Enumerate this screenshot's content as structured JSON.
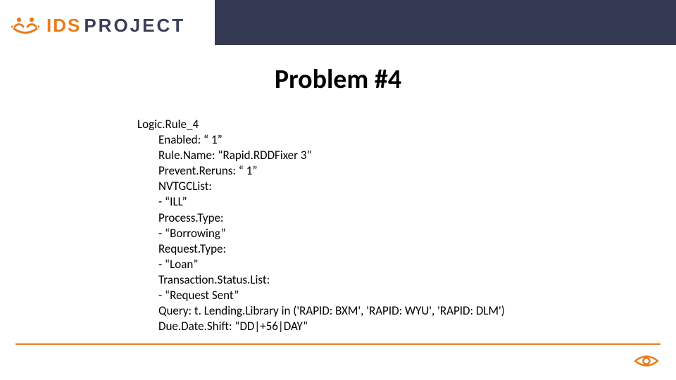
{
  "logo": {
    "ids": "IDS",
    "project": "PROJECT"
  },
  "title": "Problem #4",
  "body": {
    "root": "Logic.Rule_4",
    "lines": [
      "Enabled: “ 1”",
      "Rule.Name: “Rapid.RDDFixer 3”",
      "Prevent.Reruns: “ 1”",
      "NVTGCList:",
      "- “ILL”",
      "Process.Type:",
      "- “Borrowing”",
      "Request.Type:",
      "- “Loan”",
      "Transaction.Status.List:",
      "- “Request Sent”",
      "Query: t. Lending.Library in ('RAPID: BXM', 'RAPID: WYU', 'RAPID: DLM')",
      "Due.Date.Shift: “DD|+56|DAY”"
    ]
  }
}
